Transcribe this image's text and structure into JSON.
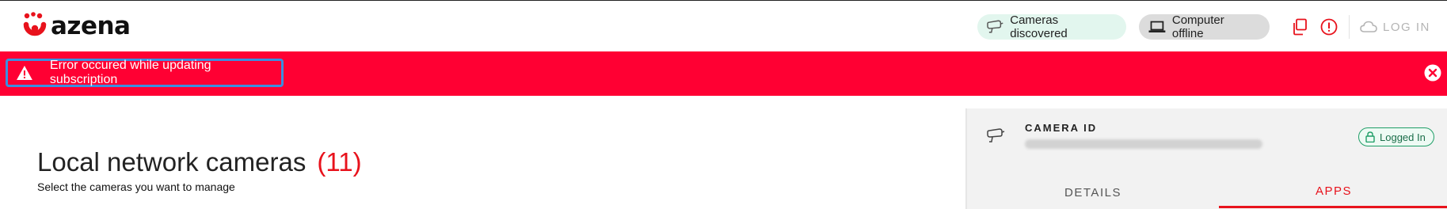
{
  "header": {
    "logo_text": "azena",
    "status_pills": [
      {
        "label": "Cameras discovered",
        "icon": "camera-icon",
        "color": "#e2f6ee"
      },
      {
        "label": "Computer offline",
        "icon": "laptop-icon",
        "color": "#dcdcdc"
      }
    ],
    "actions": {
      "copy_icon": "copy-icon",
      "info_icon": "info-icon",
      "login_label": "LOG IN",
      "login_icon": "cloud-icon"
    }
  },
  "error_bar": {
    "message": "Error occured while updating subscription",
    "icon": "warning-icon",
    "close_icon": "close-icon",
    "color": "#ff0033"
  },
  "main": {
    "title": "Local network cameras",
    "count": "(11)",
    "subtitle": "Select the cameras you want to manage"
  },
  "camera_panel": {
    "label": "CAMERA ID",
    "status_badge": "Logged In",
    "tabs": [
      {
        "label": "DETAILS",
        "active": false
      },
      {
        "label": "APPS",
        "active": true
      }
    ]
  },
  "colors": {
    "accent": "#e8121c",
    "success": "#1f9e67"
  }
}
